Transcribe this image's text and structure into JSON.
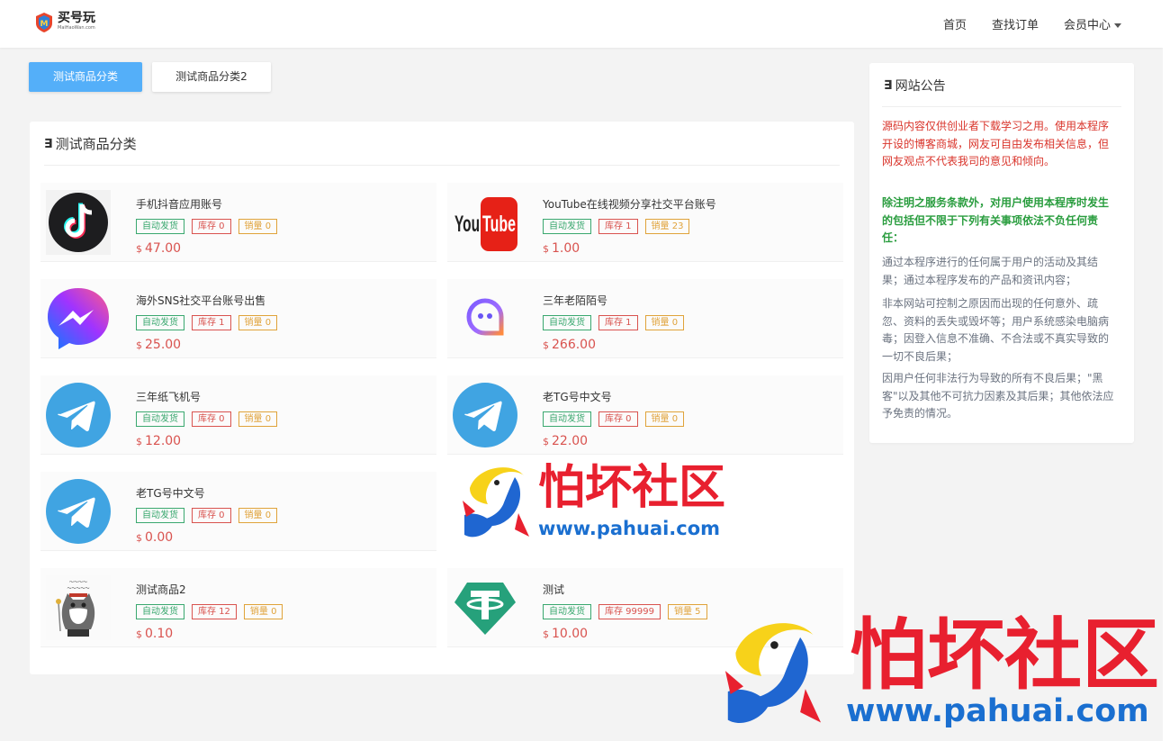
{
  "header": {
    "logo_text": "买号玩",
    "logo_sub": "MaiHaoWan.com",
    "nav": [
      {
        "label": "首页"
      },
      {
        "label": "查找订单"
      },
      {
        "label": "会员中心"
      }
    ]
  },
  "tabs": [
    {
      "label": "测试商品分类",
      "active": true
    },
    {
      "label": "测试商品分类2",
      "active": false
    }
  ],
  "panel": {
    "title": "测试商品分类",
    "products": [
      {
        "name": "手机抖音应用账号",
        "auto": "自动发货",
        "stock": "库存 0",
        "sales": "销量 0",
        "currency": "$",
        "price": "47.00",
        "icon": "tiktok-icon"
      },
      {
        "name": "YouTube在线视频分享社交平台账号",
        "auto": "自动发货",
        "stock": "库存 1",
        "sales": "销量 23",
        "currency": "$",
        "price": "1.00",
        "icon": "youtube-icon"
      },
      {
        "name": "海外SNS社交平台账号出售",
        "auto": "自动发货",
        "stock": "库存 1",
        "sales": "销量 0",
        "currency": "$",
        "price": "25.00",
        "icon": "messenger-icon"
      },
      {
        "name": "三年老陌陌号",
        "auto": "自动发货",
        "stock": "库存 1",
        "sales": "销量 0",
        "currency": "$",
        "price": "266.00",
        "icon": "momo-icon"
      },
      {
        "name": "三年纸飞机号",
        "auto": "自动发货",
        "stock": "库存 0",
        "sales": "销量 0",
        "currency": "$",
        "price": "12.00",
        "icon": "telegram-icon"
      },
      {
        "name": "老TG号中文号",
        "auto": "自动发货",
        "stock": "库存 0",
        "sales": "销量 0",
        "currency": "$",
        "price": "22.00",
        "icon": "telegram-icon"
      },
      {
        "name": "老TG号中文号",
        "auto": "自动发货",
        "stock": "库存 0",
        "sales": "销量 0",
        "currency": "$",
        "price": "0.00",
        "icon": "telegram-icon"
      },
      {
        "name": "测试商品2",
        "auto": "自动发货",
        "stock": "库存 12",
        "sales": "销量 0",
        "currency": "$",
        "price": "0.10",
        "icon": "cat-meme-image"
      },
      {
        "name": "测试",
        "auto": "自动发货",
        "stock": "库存 99999",
        "sales": "销量 5",
        "currency": "$",
        "price": "10.00",
        "icon": "tether-icon"
      }
    ]
  },
  "notice": {
    "title": "网站公告",
    "p1": "源码内容仅供创业者下载学习之用。使用本程序开设的博客商城，网友可自由发布相关信息，但网友观点不代表我司的意见和倾向。",
    "p2": "除注明之服务条款外，对用户使用本程序时发生的包括但不限于下列有关事项依法不负任何责任：",
    "p3": "通过本程序进行的任何属于用户的活动及其结果；通过本程序发布的产品和资讯内容；",
    "p4": "非本网站可控制之原因而出现的任何意外、疏忽、资料的丢失或毁坏等；用户系统感染电脑病毒；因登入信息不准确、不合法或不真实导致的一切不良后果；",
    "p5": "因用户任何非法行为导致的所有不良后果；\"黑客\"以及其他不可抗力因素及其后果；其他依法应予免责的情况。"
  },
  "watermark": {
    "text": "怕坏社区",
    "url": "www.pahuai.com"
  },
  "colors": {
    "accent": "#54aff9",
    "price": "#d9534f",
    "badge_auto": "#3aa86f",
    "badge_stock": "#d9534f",
    "badge_sales": "#e0a33a"
  }
}
